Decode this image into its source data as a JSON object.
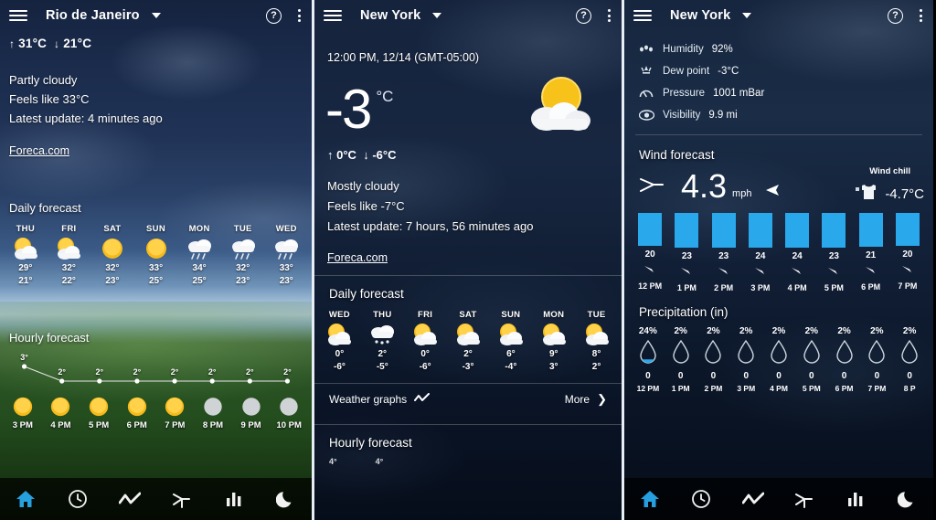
{
  "colors": {
    "accent_blue": "#29a8ec",
    "nav_active": "#29a8ec",
    "text": "#ffffff",
    "sun": "#f5b81c",
    "moon": "#d8d8d8"
  },
  "panel1": {
    "appbar": {
      "city": "Rio de Janeiro",
      "menu_icon": "hamburger-icon",
      "help_icon": "help-circle-icon",
      "overflow_icon": "kebab-menu-icon",
      "dropdown_icon": "caret-down-icon"
    },
    "high": "31°C",
    "low": "21°C",
    "condition": "Partly cloudy",
    "feels_like": "Feels like 33°C",
    "latest_update": "Latest update: 4 minutes ago",
    "source_link": "Foreca.com",
    "daily_title": "Daily forecast",
    "daily": [
      {
        "day": "THU",
        "icon": "partly-cloudy-icon",
        "high": "29°",
        "low": "21°"
      },
      {
        "day": "FRI",
        "icon": "partly-cloudy-icon",
        "high": "32°",
        "low": "22°"
      },
      {
        "day": "SAT",
        "icon": "sunny-icon",
        "high": "32°",
        "low": "23°"
      },
      {
        "day": "SUN",
        "icon": "sunny-icon",
        "high": "33°",
        "low": "25°"
      },
      {
        "day": "MON",
        "icon": "rain-icon",
        "high": "34°",
        "low": "25°"
      },
      {
        "day": "TUE",
        "icon": "rain-icon",
        "high": "32°",
        "low": "23°"
      },
      {
        "day": "WED",
        "icon": "rain-icon",
        "high": "33°",
        "low": "23°"
      }
    ],
    "hourly_title": "Hourly forecast",
    "hourly": [
      {
        "temp": "3°",
        "icon": "sunny-icon",
        "time": "3 PM"
      },
      {
        "temp": "2°",
        "icon": "sunny-icon",
        "time": "4 PM"
      },
      {
        "temp": "2°",
        "icon": "sunny-icon",
        "time": "5 PM"
      },
      {
        "temp": "2°",
        "icon": "sunny-icon",
        "time": "6 PM"
      },
      {
        "temp": "2°",
        "icon": "sunny-icon",
        "time": "7 PM"
      },
      {
        "temp": "2°",
        "icon": "moon-icon",
        "time": "8 PM"
      },
      {
        "temp": "2°",
        "icon": "moon-icon",
        "time": "9 PM"
      },
      {
        "temp": "2°",
        "icon": "moon-icon",
        "time": "10 PM"
      }
    ]
  },
  "panel2": {
    "appbar": {
      "city": "New York",
      "menu_icon": "hamburger-icon",
      "help_icon": "help-circle-icon",
      "overflow_icon": "kebab-menu-icon",
      "dropdown_icon": "caret-down-icon"
    },
    "timestamp": "12:00 PM, 12/14 (GMT-05:00)",
    "temperature": "-3",
    "unit": "°C",
    "current_icon": "partly-cloudy-icon",
    "high": "0°C",
    "low": "-6°C",
    "condition": "Mostly cloudy",
    "feels_like": "Feels like -7°C",
    "latest_update": "Latest update: 7 hours, 56 minutes ago",
    "source_link": "Foreca.com",
    "daily_title": "Daily forecast",
    "daily": [
      {
        "day": "WED",
        "icon": "partly-cloudy-icon",
        "high": "0°",
        "low": "-6°"
      },
      {
        "day": "THU",
        "icon": "snow-icon",
        "high": "2°",
        "low": "-5°"
      },
      {
        "day": "FRI",
        "icon": "partly-cloudy-icon",
        "high": "0°",
        "low": "-6°"
      },
      {
        "day": "SAT",
        "icon": "partly-cloudy-icon",
        "high": "2°",
        "low": "-3°"
      },
      {
        "day": "SUN",
        "icon": "partly-cloudy-icon",
        "high": "6°",
        "low": "-4°"
      },
      {
        "day": "MON",
        "icon": "partly-cloudy-icon",
        "high": "9°",
        "low": "3°"
      },
      {
        "day": "TUE",
        "icon": "partly-cloudy-icon",
        "high": "8°",
        "low": "2°"
      }
    ],
    "graphs_label": "Weather graphs",
    "graphs_icon": "line-chart-icon",
    "more_label": "More",
    "more_icon": "chevron-right-icon",
    "hourly_title": "Hourly forecast",
    "hourly_cut": [
      "4°",
      "4°"
    ]
  },
  "panel3": {
    "appbar": {
      "city": "New York",
      "menu_icon": "hamburger-icon",
      "help_icon": "help-circle-icon",
      "overflow_icon": "kebab-menu-icon",
      "dropdown_icon": "caret-down-icon"
    },
    "details": [
      {
        "icon": "humidity-icon",
        "label": "Humidity",
        "value": "92%"
      },
      {
        "icon": "dew-point-icon",
        "label": "Dew point",
        "value": "-3°C"
      },
      {
        "icon": "pressure-icon",
        "label": "Pressure",
        "value": "1001 mBar"
      },
      {
        "icon": "visibility-eye-icon",
        "label": "Visibility",
        "value": "9.9 mi"
      }
    ],
    "wind_title": "Wind forecast",
    "wind_icon": "windmill-icon",
    "wind_speed": "4.3",
    "wind_unit": "mph",
    "wind_direction_icon": "wind-direction-arrow-icon",
    "wind_chill_label": "Wind chill",
    "wind_chill_icon": "tshirt-icon",
    "wind_chill_value": "-4.7°C",
    "wind_bars": [
      {
        "value": "20",
        "time": "12 PM"
      },
      {
        "value": "23",
        "time": "1 PM"
      },
      {
        "value": "23",
        "time": "2 PM"
      },
      {
        "value": "24",
        "time": "3 PM"
      },
      {
        "value": "24",
        "time": "4 PM"
      },
      {
        "value": "23",
        "time": "5 PM"
      },
      {
        "value": "21",
        "time": "6 PM"
      },
      {
        "value": "20",
        "time": "7 PM"
      }
    ],
    "precip_title": "Precipitation (in)",
    "precip": [
      {
        "pct": "24%",
        "amount": "0",
        "time": "12 PM",
        "fill": 0.3
      },
      {
        "pct": "2%",
        "amount": "0",
        "time": "1 PM",
        "fill": 0
      },
      {
        "pct": "2%",
        "amount": "0",
        "time": "2 PM",
        "fill": 0
      },
      {
        "pct": "2%",
        "amount": "0",
        "time": "3 PM",
        "fill": 0
      },
      {
        "pct": "2%",
        "amount": "0",
        "time": "4 PM",
        "fill": 0
      },
      {
        "pct": "2%",
        "amount": "0",
        "time": "5 PM",
        "fill": 0
      },
      {
        "pct": "2%",
        "amount": "0",
        "time": "6 PM",
        "fill": 0
      },
      {
        "pct": "2%",
        "amount": "0",
        "time": "7 PM",
        "fill": 0
      },
      {
        "pct": "2%",
        "amount": "0",
        "time": "8 P",
        "fill": 0
      }
    ]
  },
  "nav": {
    "items": [
      {
        "icon": "home-icon",
        "active": true
      },
      {
        "icon": "clock-icon",
        "active": false
      },
      {
        "icon": "line-chart-icon",
        "active": false
      },
      {
        "icon": "windmill-icon",
        "active": false
      },
      {
        "icon": "bar-chart-icon",
        "active": false
      },
      {
        "icon": "moon-icon",
        "active": false
      }
    ]
  },
  "chart_data": {
    "type": "line",
    "title": "Hourly forecast",
    "x": [
      "3 PM",
      "4 PM",
      "5 PM",
      "6 PM",
      "7 PM",
      "8 PM",
      "9 PM",
      "10 PM"
    ],
    "values": [
      3,
      2,
      2,
      2,
      2,
      2,
      2,
      2
    ],
    "ylabel": "°C",
    "xlabel": "",
    "ylim": [
      1,
      4
    ],
    "grid": false,
    "legend": "none"
  }
}
